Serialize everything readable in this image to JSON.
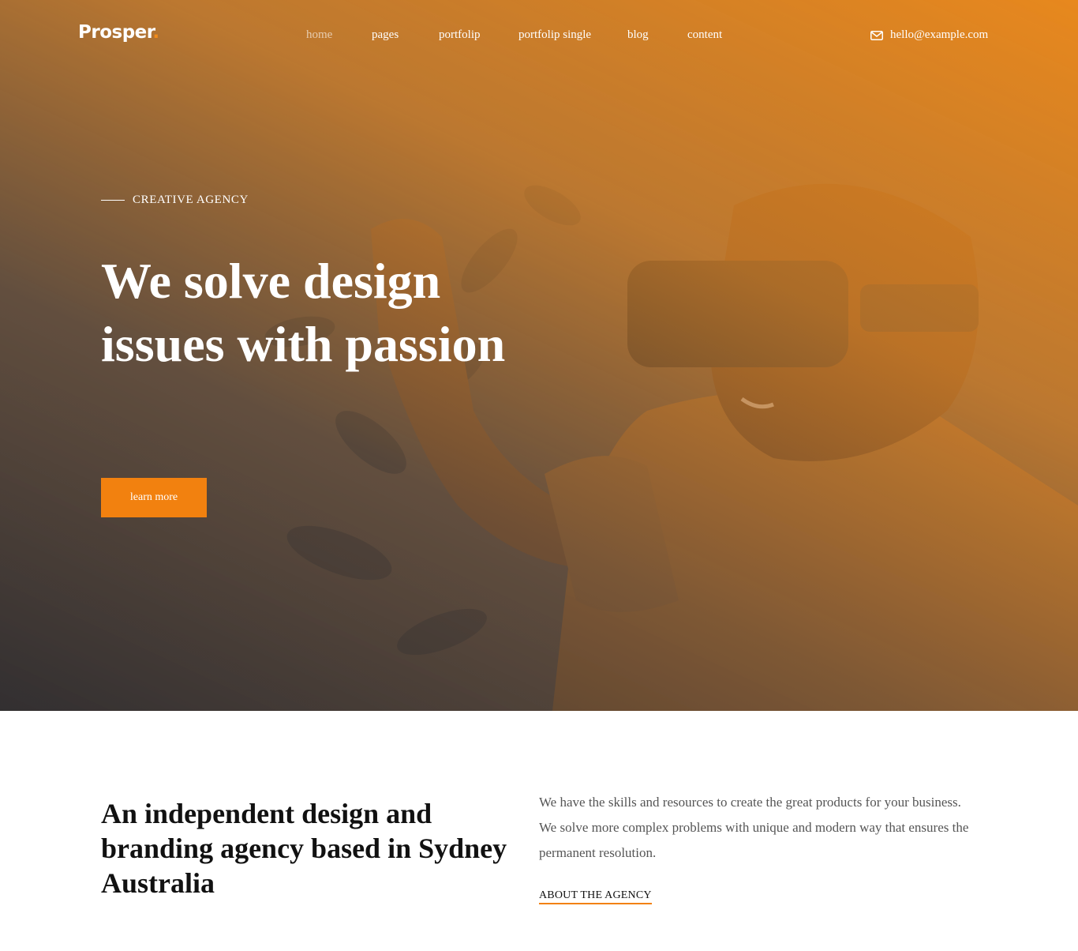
{
  "brand": {
    "name": "Prosper",
    "dot": ".",
    "accent": "#f2810f"
  },
  "nav": {
    "items": [
      {
        "label": "home",
        "active": true
      },
      {
        "label": "pages"
      },
      {
        "label": "portfolip"
      },
      {
        "label": "portfolip single"
      },
      {
        "label": "blog"
      },
      {
        "label": "content"
      }
    ],
    "email": "hello@example.com",
    "email_icon": "envelope-icon"
  },
  "hero": {
    "eyebrow": "CREATIVE AGENCY",
    "title": "We solve design issues with passion",
    "button_label": "learn more",
    "overlay_colors": [
      "#f28c1a",
      "#2d2d32"
    ]
  },
  "about": {
    "title": "An independent design and branding agency based in Sydney Australia",
    "text": "We have the skills and resources to create the great products for your business. We solve more complex problems with unique and modern way that ensures the permanent resolution.",
    "link_label": "ABOUT THE AGENCY"
  }
}
